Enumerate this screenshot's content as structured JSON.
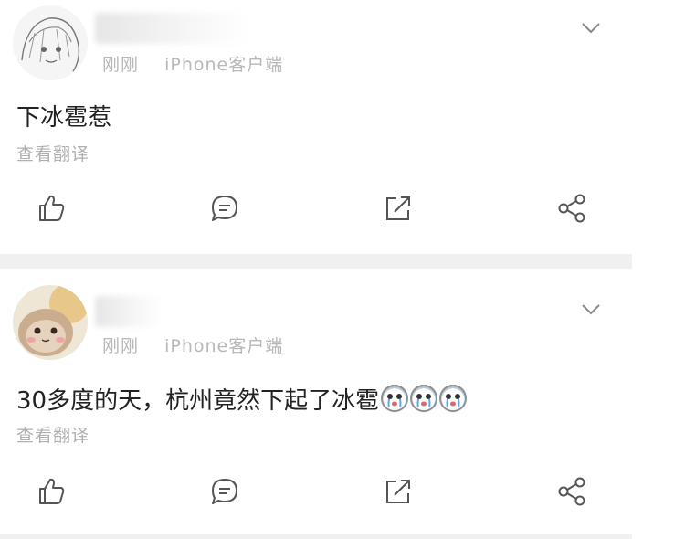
{
  "posts": [
    {
      "time": "刚刚",
      "source": "iPhone客户端",
      "content": "下冰雹惹",
      "translate_label": "查看翻译"
    },
    {
      "time": "刚刚",
      "source": "iPhone客户端",
      "content": "30多度的天，杭州竟然下起了冰雹",
      "translate_label": "查看翻译",
      "emojis": [
        "crying-face-emoji",
        "crying-face-emoji",
        "crying-face-emoji"
      ]
    }
  ],
  "icons": [
    "chevron-down-icon",
    "like-icon",
    "comment-icon",
    "repost-icon",
    "share-icon"
  ],
  "colors": {
    "meta": "#b8b8b8",
    "text": "#222222",
    "divider": "#f0f0f0",
    "icon": "#555555"
  }
}
